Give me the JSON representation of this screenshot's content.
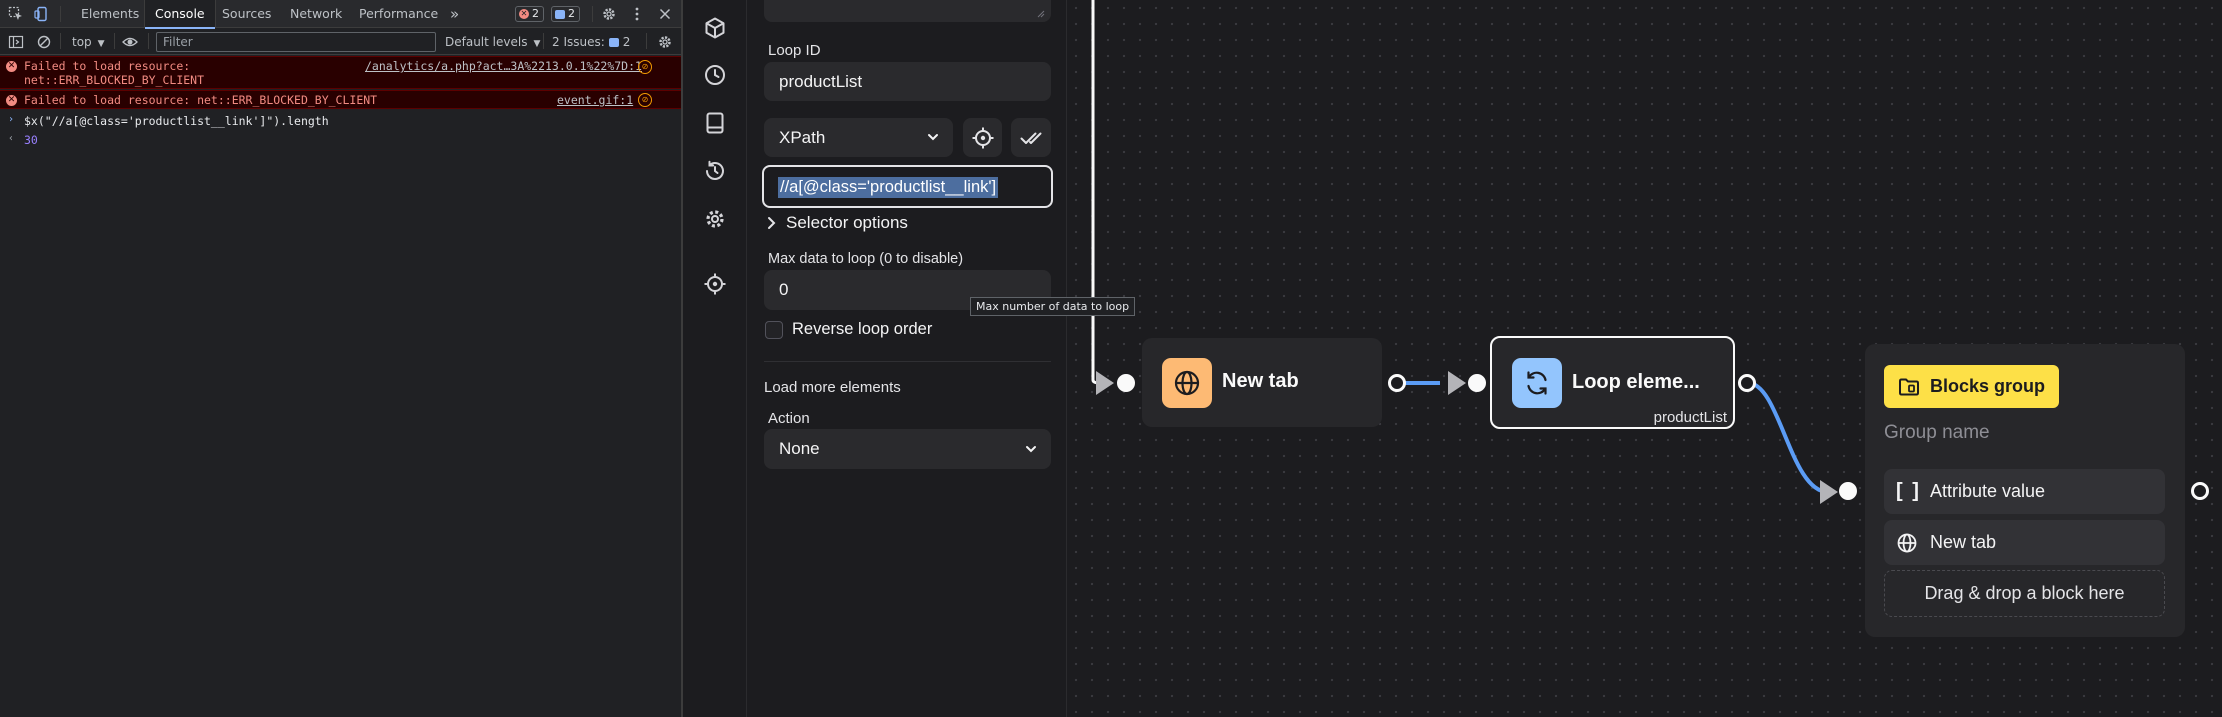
{
  "devtools": {
    "tabs": [
      "Elements",
      "Console",
      "Sources",
      "Network",
      "Performance"
    ],
    "more_tabs": "»",
    "error_count": "2",
    "message_count": "2",
    "context": "top",
    "filter_placeholder": "Filter",
    "levels": "Default levels",
    "issues_label": "2 Issues:",
    "issues_count": "2",
    "console": {
      "errors": [
        {
          "text": "Failed to load resource:\nnet::ERR_BLOCKED_BY_CLIENT",
          "source": "/analytics/a.php?act…3A%2213.0.1%22%7D:1"
        },
        {
          "text": "Failed to load resource: net::ERR_BLOCKED_BY_CLIENT",
          "source": "event.gif:1"
        }
      ],
      "input": "$x(\"//a[@class='productlist__link']\").length",
      "result": "30"
    }
  },
  "rail": {
    "icons": [
      "cube-icon",
      "clock-icon",
      "tablet-icon",
      "history-icon",
      "settings-icon",
      "crosshair-icon"
    ]
  },
  "editor": {
    "loop_id_label": "Loop ID",
    "loop_id_value": "productList",
    "selector_type": "XPath",
    "selector_value": "//a[@class='productlist__link']",
    "selector_options": "Selector options",
    "max_data_label": "Max data to loop (0 to disable)",
    "max_data_value": "0",
    "max_data_tooltip": "Max number of data to loop",
    "reverse_label": "Reverse loop order",
    "reverse_checked": false,
    "load_more_label": "Load more elements",
    "action_label": "Action",
    "action_value": "None"
  },
  "canvas": {
    "new_tab_node": {
      "title": "New tab",
      "icon": "globe-icon",
      "color": "#fdba74"
    },
    "loop_node": {
      "title": "Loop eleme...",
      "subtitle": "productList",
      "icon": "refresh-icon",
      "color": "#93c5fd"
    },
    "group_node": {
      "badge": "Blocks group",
      "badge_color": "#fde047",
      "name_placeholder": "Group name",
      "items": [
        {
          "label": "Attribute value",
          "icon": "brackets-icon"
        },
        {
          "label": "New tab",
          "icon": "globe-icon"
        }
      ],
      "drop_hint": "Drag & drop a block here"
    },
    "edge_color": "#5b9cf5"
  }
}
